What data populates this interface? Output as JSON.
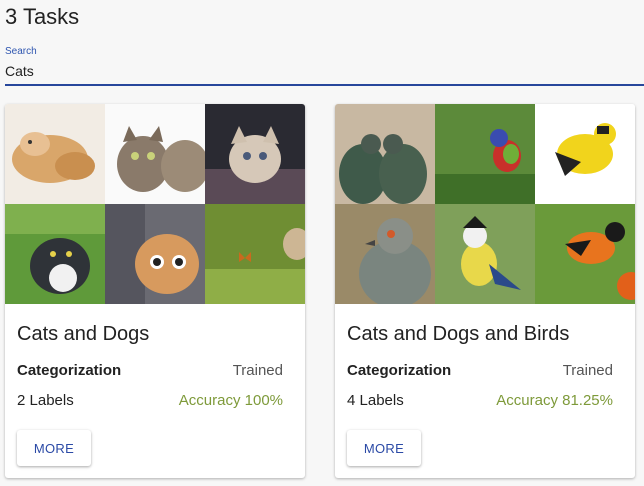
{
  "page": {
    "title": "3 Tasks"
  },
  "search": {
    "label": "Search",
    "value": "Cats"
  },
  "cards": [
    {
      "title": "Cats and Dogs",
      "task_type": "Categorization",
      "status": "Trained",
      "labels": "2 Labels",
      "accuracy": "Accuracy 100%",
      "button": "MORE",
      "images": [
        "kitten-lying",
        "two-kittens",
        "kitten-blanket",
        "cat-on-grass",
        "cat-peeking",
        "cat-with-butterfly"
      ]
    },
    {
      "title": "Cats and Dogs and Birds",
      "task_type": "Categorization",
      "status": "Trained",
      "labels": "4 Labels",
      "accuracy": "Accuracy 81.25%",
      "button": "MORE",
      "images": [
        "pigeons-pair",
        "painted-bunting",
        "goldfinch",
        "pigeon-head",
        "blue-tit",
        "oriole"
      ]
    }
  ],
  "colors": {
    "accent": "#27479c",
    "accuracy": "#7e9a3a",
    "button_text": "#2b4aa6"
  }
}
